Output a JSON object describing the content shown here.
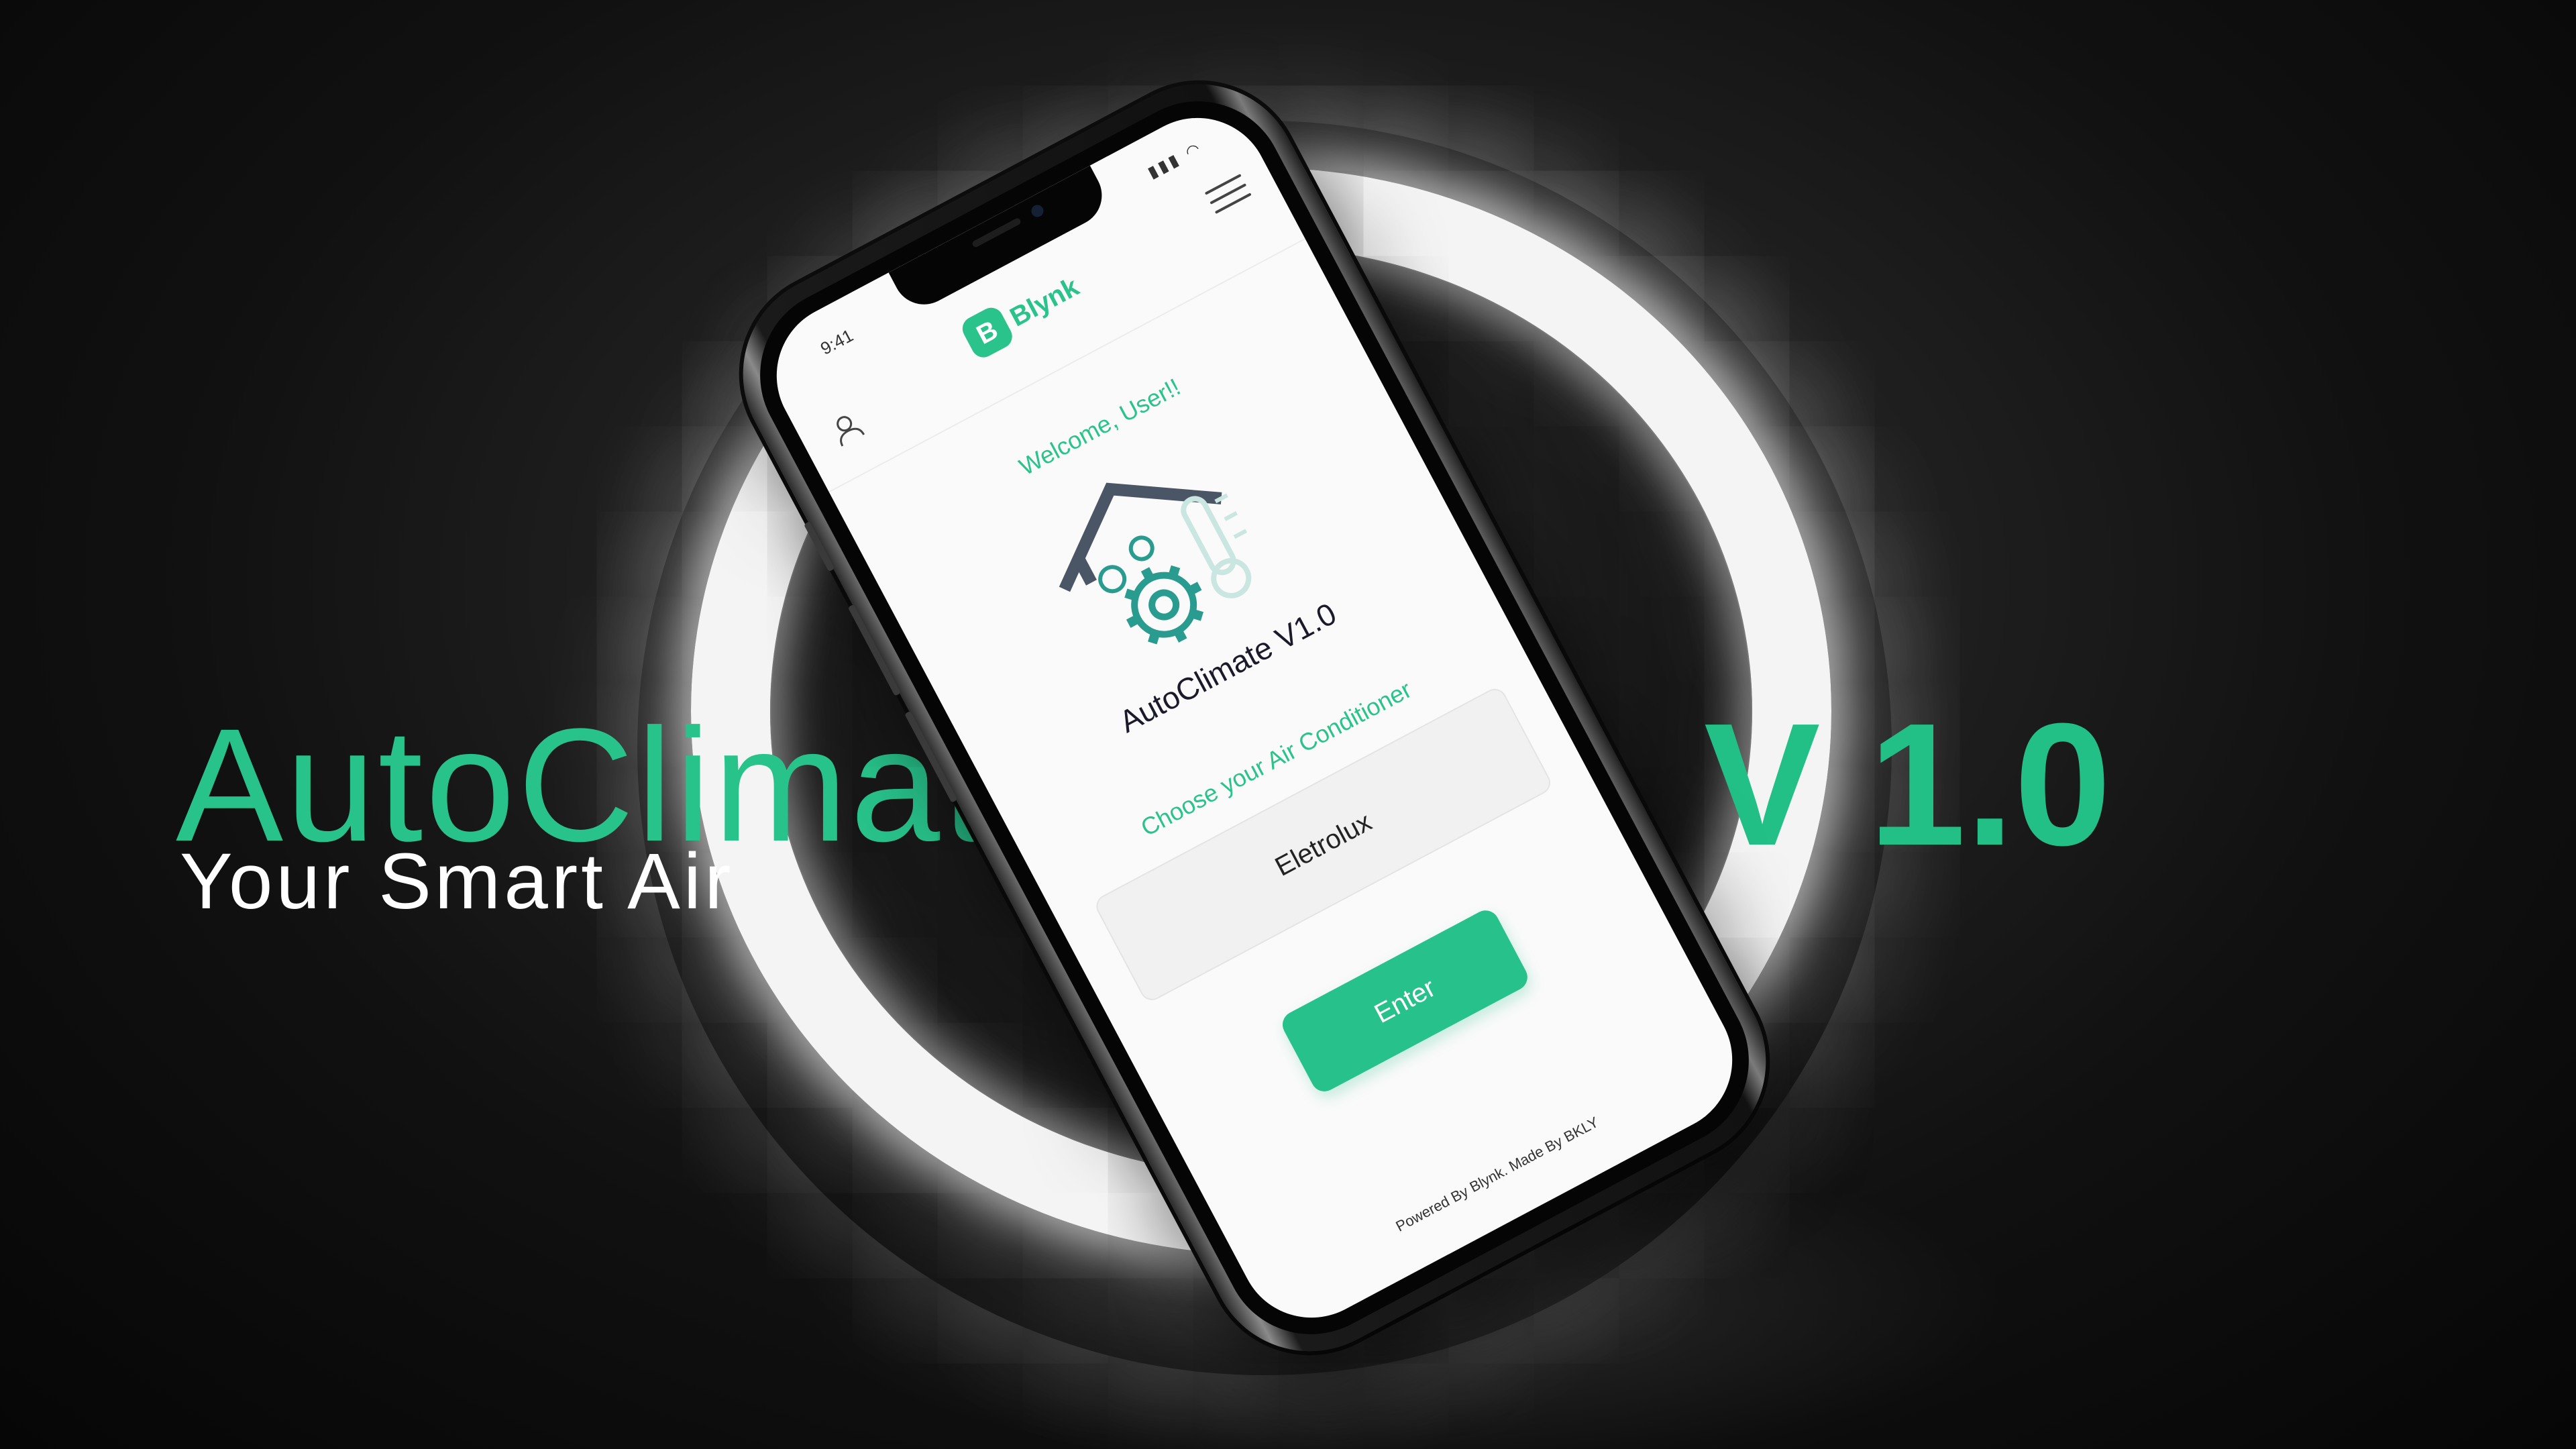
{
  "hero": {
    "title": "AutoClimate",
    "subtitle": "Your Smart Air",
    "version": "V 1.0"
  },
  "colors": {
    "accent": "#27c18b",
    "background": "#111111",
    "ring": "#f4f4f4"
  },
  "phone": {
    "status_time": "9:41",
    "status_icons": "▮▮▮ ◠",
    "brand_logo_letter": "B",
    "brand_name": "Blynk",
    "welcome": "Welcome, User!!",
    "logo_text": "AutoClimate V1.0",
    "choose_label": "Choose your Air Conditioner",
    "selected_ac": "Eletrolux",
    "enter_label": "Enter",
    "footer": "Powered By Blynk. Made By BKLY",
    "icons": [
      "user-icon",
      "menu-icon",
      "house-gear-thermometer-logo"
    ]
  }
}
